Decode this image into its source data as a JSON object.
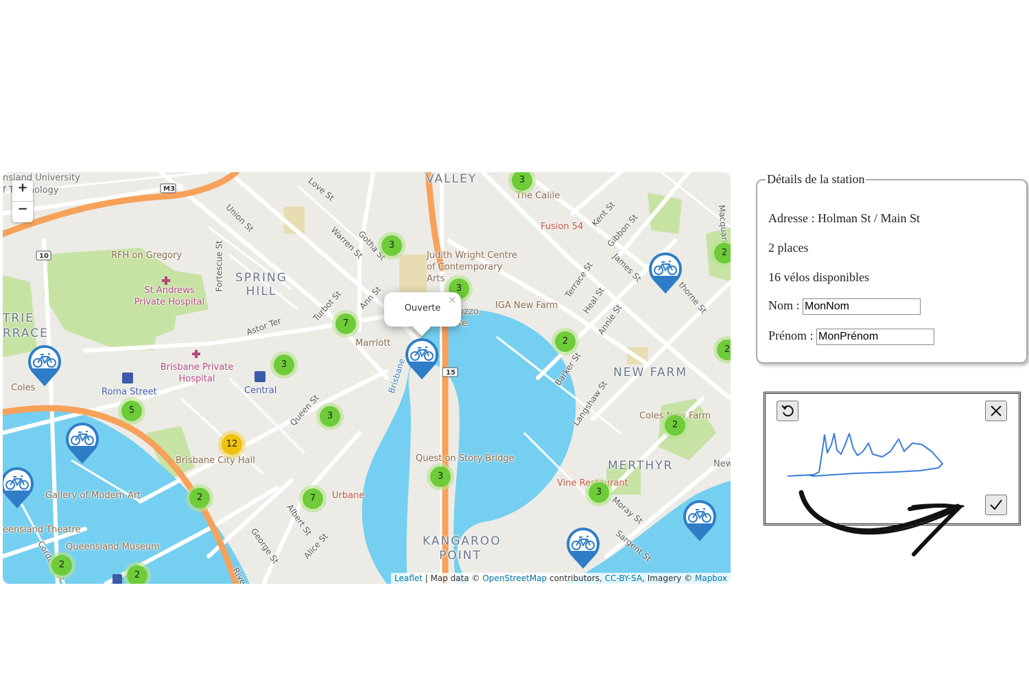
{
  "map": {
    "zoom_in": "+",
    "zoom_out": "−",
    "popup": {
      "text": "Ouverte",
      "close": "×"
    },
    "attribution": {
      "leaflet": "Leaflet",
      "sep": " | Map data © ",
      "osm": "OpenStreetMap",
      "contrib": " contributors, ",
      "ccbysa": "CC-BY-SA",
      "imagery": ", Imagery © ",
      "mapbox": "Mapbox"
    },
    "labels": {
      "valley": "VALLEY",
      "spring_hill": "SPRING HILL",
      "new_farm": "NEW FARM",
      "merthyr": "MERTHYR",
      "kangaroo_point": "KANGAROO POINT",
      "terrace_1": "TRIE",
      "terrace_2": "RRACE",
      "uni": "nsland University",
      "tech": "f Technology",
      "rfh": "RFH on Gregory",
      "st_andrews": "St Andrews Private Hospital",
      "brisbane_private": "Brisbane Private Hospital",
      "roma_street": "Roma Street",
      "central": "Central",
      "city_hall": "Brisbane City Hall",
      "gallery": "Gallery of Modern Art",
      "qld_theatre": "eensland Theatre",
      "qld_museum": "Queensland Museum",
      "marriott": "Marriott",
      "judith": "Judith Wright Centre of Contemporary Arts",
      "iga": "IGA New Farm",
      "calile": "The Calile",
      "fusion": "Fusion 54",
      "coles_farm": "Coles New Farm",
      "coles": "Coles",
      "quest": "Quest on Story Bridge",
      "vine": "Vine Restaurant",
      "urbane": "Urbane",
      "azzo": "uzzo,",
      "azzo2": "te",
      "brisbane_river": "Brisbane",
      "new": "New",
      "love_st": "Love St",
      "union_st": "Union St",
      "warren_st": "Warren St",
      "gotha_st": "Gotha St",
      "fortescue_st": "Fortescue St",
      "astor_ter": "Astor Ter",
      "turbot_st": "Turbot St",
      "ann_st": "Ann St",
      "queen_st": "Queen St",
      "albert_st": "Albert St",
      "george_st": "George St",
      "alice_st": "Alice St",
      "kent_st": "Kent St",
      "gibbon_st": "Gibbon St",
      "james_st": "James St",
      "terrace_st": "Terrace St",
      "heal_st": "Heal St",
      "annie_st": "Annie St",
      "barker_st": "Barker St",
      "langshaw_st": "Langshaw St",
      "moray_st": "Moray St",
      "sargent_st": "Sargent St",
      "hawthorne_st": "thorne St",
      "macquarie_st": "Macquarie St",
      "cordelia_st": "Cordelia St",
      "river": "Rive",
      "m3": "M3",
      "r10": "10",
      "r15": "15"
    },
    "clusters": [
      {
        "count": "3"
      },
      {
        "count": "3"
      },
      {
        "count": "3"
      },
      {
        "count": "7"
      },
      {
        "count": "3"
      },
      {
        "count": "5"
      },
      {
        "count": "3"
      },
      {
        "count": "12",
        "color": "yellow"
      },
      {
        "count": "2"
      },
      {
        "count": "7"
      },
      {
        "count": "3"
      },
      {
        "count": "2"
      },
      {
        "count": "2"
      },
      {
        "count": "3"
      },
      {
        "count": "2"
      },
      {
        "count": "2"
      },
      {
        "count": "2"
      },
      {
        "count": "2"
      }
    ],
    "markers": [
      "bike-marker",
      "bike-marker",
      "bike-marker",
      "bike-marker",
      "bike-marker",
      "bike-marker",
      "bike-marker"
    ],
    "colors": {
      "water": "#75cff0",
      "park": "#c6e3a4",
      "road": "#ffffff",
      "highway": "#f7a159",
      "cluster": "#6ecc39",
      "marker": "#2f7dc7"
    }
  },
  "details": {
    "legend": "Détails de la station",
    "address_label": "Adresse : ",
    "address": "Holman St / Main St",
    "places": "2 places",
    "bikes": "16 vélos disponibles",
    "nom_label": "Nom : ",
    "nom_value": "MonNom",
    "prenom_label": "Prénom : ",
    "prenom_value": "MonPrénom"
  },
  "signature": {
    "reset_icon": "undo-icon",
    "close_icon": "close-icon",
    "validate_icon": "check-icon"
  }
}
